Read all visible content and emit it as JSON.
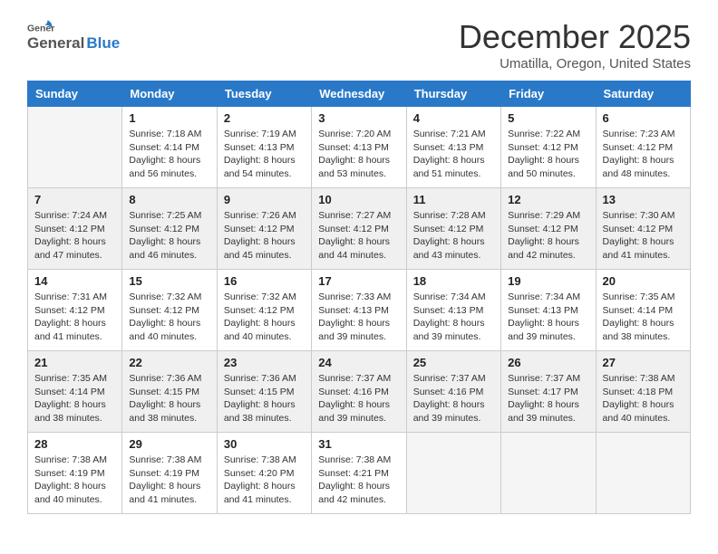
{
  "header": {
    "logo": {
      "general": "General",
      "blue": "Blue"
    },
    "title": "December 2025",
    "location": "Umatilla, Oregon, United States"
  },
  "weekdays": [
    "Sunday",
    "Monday",
    "Tuesday",
    "Wednesday",
    "Thursday",
    "Friday",
    "Saturday"
  ],
  "weeks": [
    [
      {
        "day": "",
        "empty": true
      },
      {
        "day": "1",
        "sunrise": "7:18 AM",
        "sunset": "4:14 PM",
        "daylight": "8 hours and 56 minutes."
      },
      {
        "day": "2",
        "sunrise": "7:19 AM",
        "sunset": "4:13 PM",
        "daylight": "8 hours and 54 minutes."
      },
      {
        "day": "3",
        "sunrise": "7:20 AM",
        "sunset": "4:13 PM",
        "daylight": "8 hours and 53 minutes."
      },
      {
        "day": "4",
        "sunrise": "7:21 AM",
        "sunset": "4:13 PM",
        "daylight": "8 hours and 51 minutes."
      },
      {
        "day": "5",
        "sunrise": "7:22 AM",
        "sunset": "4:12 PM",
        "daylight": "8 hours and 50 minutes."
      },
      {
        "day": "6",
        "sunrise": "7:23 AM",
        "sunset": "4:12 PM",
        "daylight": "8 hours and 48 minutes."
      }
    ],
    [
      {
        "day": "7",
        "sunrise": "7:24 AM",
        "sunset": "4:12 PM",
        "daylight": "8 hours and 47 minutes."
      },
      {
        "day": "8",
        "sunrise": "7:25 AM",
        "sunset": "4:12 PM",
        "daylight": "8 hours and 46 minutes."
      },
      {
        "day": "9",
        "sunrise": "7:26 AM",
        "sunset": "4:12 PM",
        "daylight": "8 hours and 45 minutes."
      },
      {
        "day": "10",
        "sunrise": "7:27 AM",
        "sunset": "4:12 PM",
        "daylight": "8 hours and 44 minutes."
      },
      {
        "day": "11",
        "sunrise": "7:28 AM",
        "sunset": "4:12 PM",
        "daylight": "8 hours and 43 minutes."
      },
      {
        "day": "12",
        "sunrise": "7:29 AM",
        "sunset": "4:12 PM",
        "daylight": "8 hours and 42 minutes."
      },
      {
        "day": "13",
        "sunrise": "7:30 AM",
        "sunset": "4:12 PM",
        "daylight": "8 hours and 41 minutes."
      }
    ],
    [
      {
        "day": "14",
        "sunrise": "7:31 AM",
        "sunset": "4:12 PM",
        "daylight": "8 hours and 41 minutes."
      },
      {
        "day": "15",
        "sunrise": "7:32 AM",
        "sunset": "4:12 PM",
        "daylight": "8 hours and 40 minutes."
      },
      {
        "day": "16",
        "sunrise": "7:32 AM",
        "sunset": "4:12 PM",
        "daylight": "8 hours and 40 minutes."
      },
      {
        "day": "17",
        "sunrise": "7:33 AM",
        "sunset": "4:13 PM",
        "daylight": "8 hours and 39 minutes."
      },
      {
        "day": "18",
        "sunrise": "7:34 AM",
        "sunset": "4:13 PM",
        "daylight": "8 hours and 39 minutes."
      },
      {
        "day": "19",
        "sunrise": "7:34 AM",
        "sunset": "4:13 PM",
        "daylight": "8 hours and 39 minutes."
      },
      {
        "day": "20",
        "sunrise": "7:35 AM",
        "sunset": "4:14 PM",
        "daylight": "8 hours and 38 minutes."
      }
    ],
    [
      {
        "day": "21",
        "sunrise": "7:35 AM",
        "sunset": "4:14 PM",
        "daylight": "8 hours and 38 minutes."
      },
      {
        "day": "22",
        "sunrise": "7:36 AM",
        "sunset": "4:15 PM",
        "daylight": "8 hours and 38 minutes."
      },
      {
        "day": "23",
        "sunrise": "7:36 AM",
        "sunset": "4:15 PM",
        "daylight": "8 hours and 38 minutes."
      },
      {
        "day": "24",
        "sunrise": "7:37 AM",
        "sunset": "4:16 PM",
        "daylight": "8 hours and 39 minutes."
      },
      {
        "day": "25",
        "sunrise": "7:37 AM",
        "sunset": "4:16 PM",
        "daylight": "8 hours and 39 minutes."
      },
      {
        "day": "26",
        "sunrise": "7:37 AM",
        "sunset": "4:17 PM",
        "daylight": "8 hours and 39 minutes."
      },
      {
        "day": "27",
        "sunrise": "7:38 AM",
        "sunset": "4:18 PM",
        "daylight": "8 hours and 40 minutes."
      }
    ],
    [
      {
        "day": "28",
        "sunrise": "7:38 AM",
        "sunset": "4:19 PM",
        "daylight": "8 hours and 40 minutes."
      },
      {
        "day": "29",
        "sunrise": "7:38 AM",
        "sunset": "4:19 PM",
        "daylight": "8 hours and 41 minutes."
      },
      {
        "day": "30",
        "sunrise": "7:38 AM",
        "sunset": "4:20 PM",
        "daylight": "8 hours and 41 minutes."
      },
      {
        "day": "31",
        "sunrise": "7:38 AM",
        "sunset": "4:21 PM",
        "daylight": "8 hours and 42 minutes."
      },
      {
        "day": "",
        "empty": true
      },
      {
        "day": "",
        "empty": true
      },
      {
        "day": "",
        "empty": true
      }
    ]
  ]
}
